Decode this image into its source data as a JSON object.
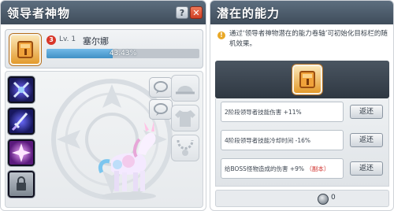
{
  "left_panel": {
    "title": "领导者神物",
    "help_label": "?",
    "close_label": "✕",
    "item": {
      "badge": "3",
      "level": "Lv. 1",
      "name": "塞尔娜",
      "progress_text": "43.43%",
      "progress_fraction": 0.4343
    },
    "skills": [
      "cross-swords-icon",
      "sword-icon",
      "purple-burst-icon",
      "locked-slot-icon"
    ],
    "equip_slots": [
      "hat-icon",
      "shirt-icon",
      "necklace-icon",
      "chat-bubble-icon",
      "chat-bubble-icon"
    ]
  },
  "right_panel": {
    "title": "潜在的能力",
    "info_text": "通过‘领导者神物潜在的能力卷轴’可初始化目标栏的随机效果。",
    "options": [
      {
        "text": "2阶段领导者技能伤害 +11%",
        "tag": "",
        "button": "返还"
      },
      {
        "text": "4阶段领导者技能冷却时间 -16%",
        "tag": "",
        "button": "返还"
      },
      {
        "text": "给BOSS怪物造成的伤害 +9%",
        "tag": "（副本）",
        "button": "返还"
      }
    ],
    "bottom_count": "0"
  },
  "colors": {
    "titlebar": "#4a5868",
    "progress": "#5aa4d6",
    "close": "#d9452c",
    "accent_gold": "#e39a2c"
  }
}
